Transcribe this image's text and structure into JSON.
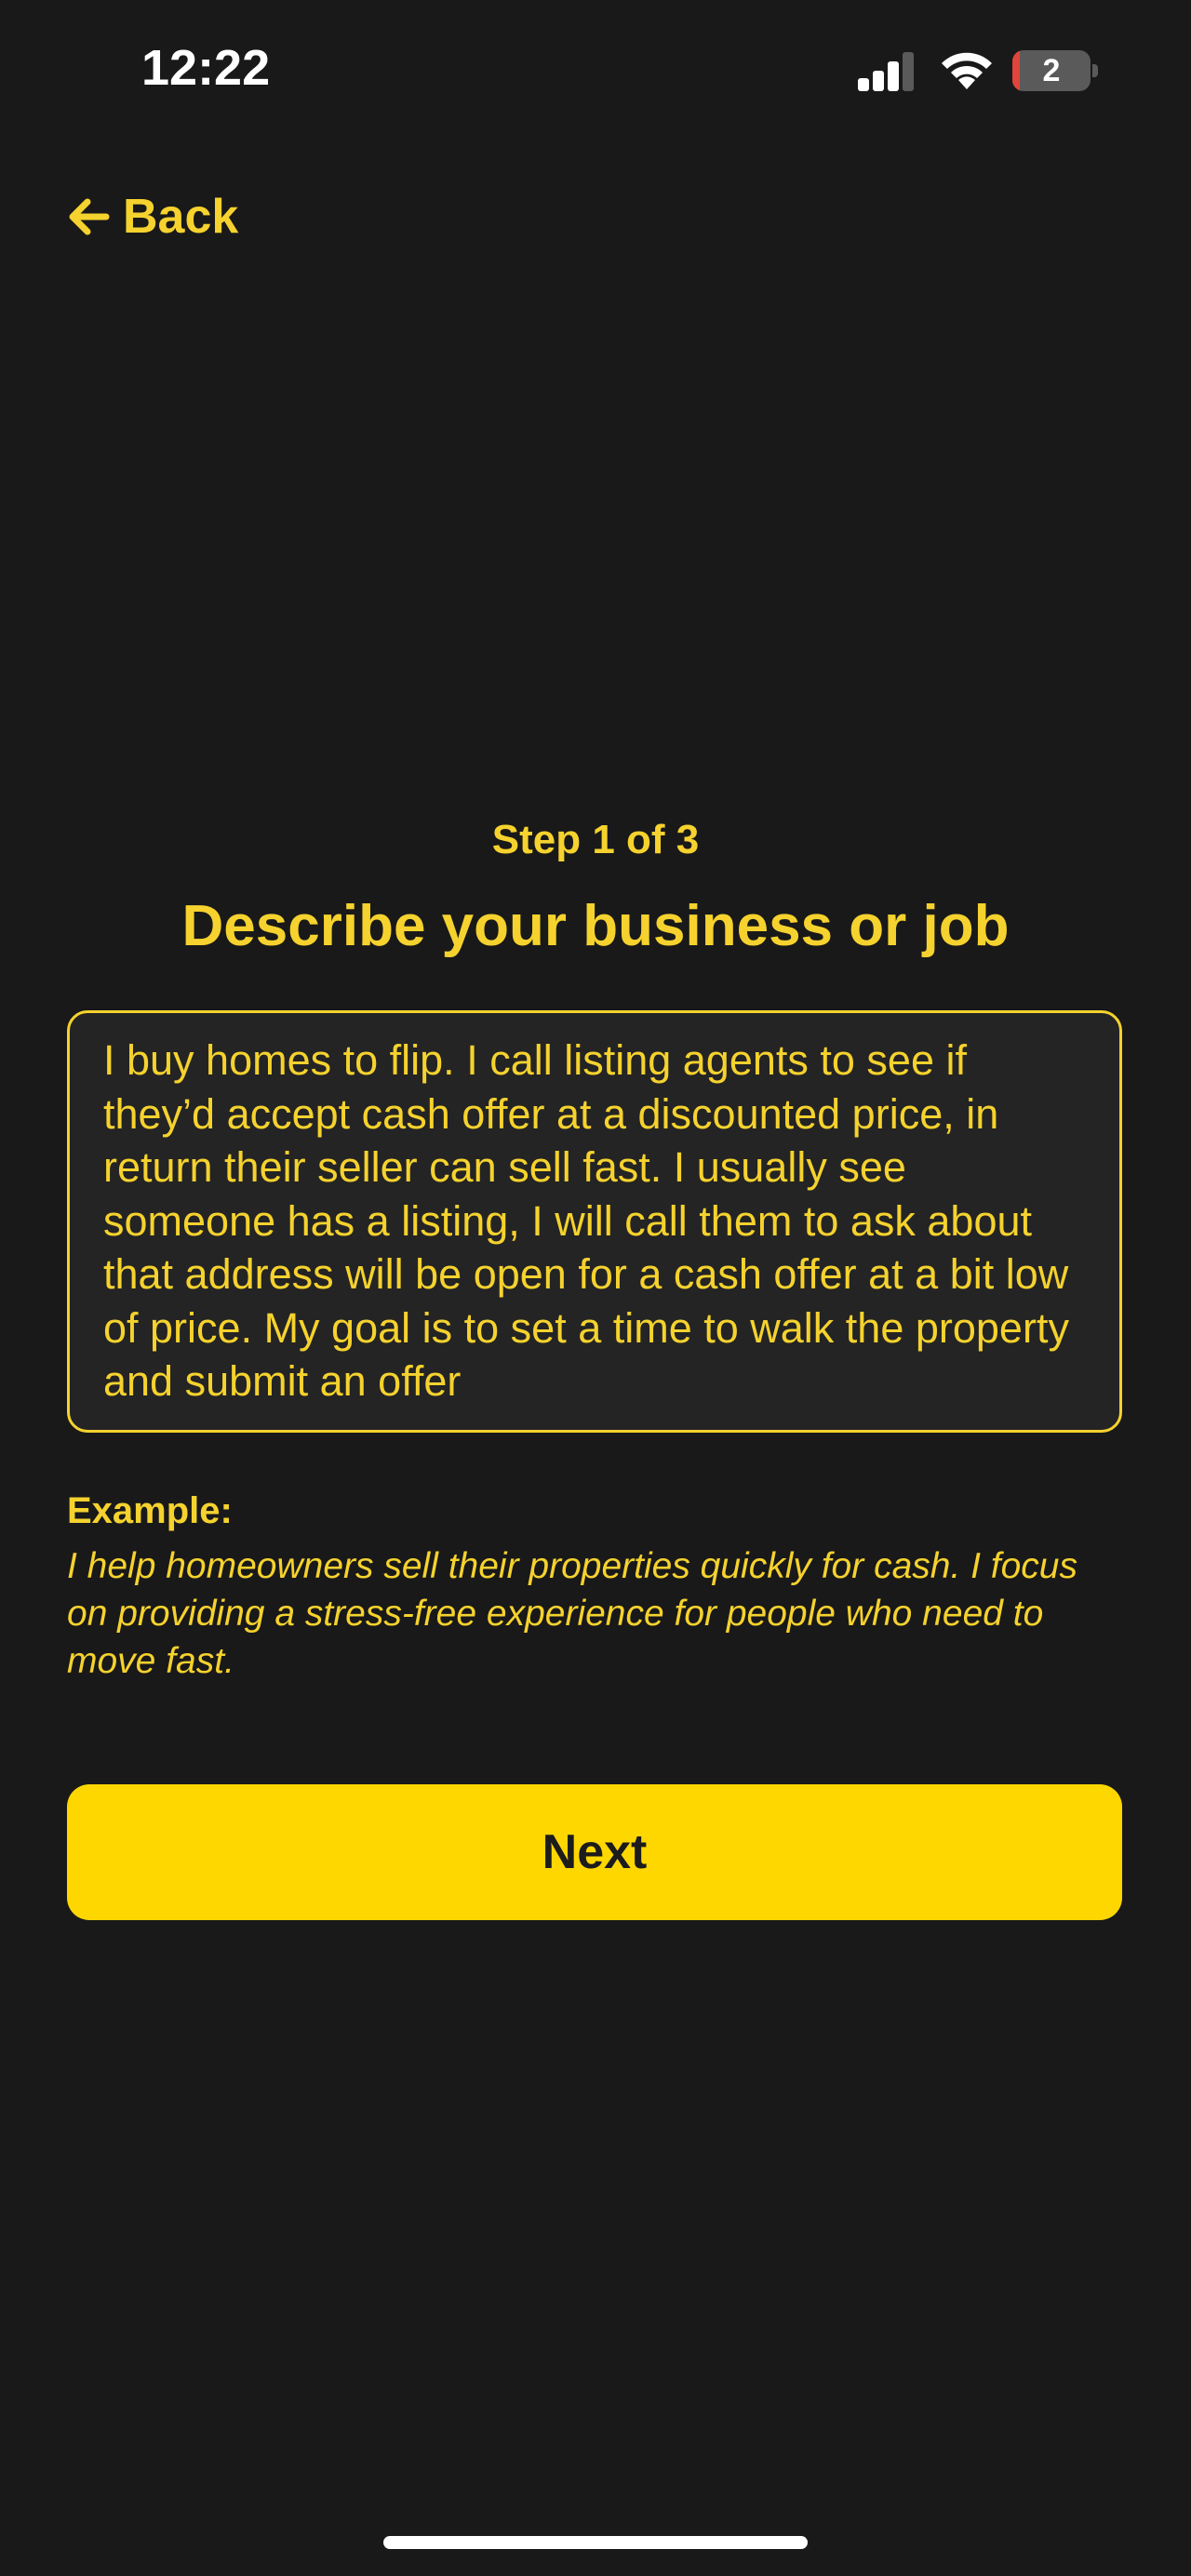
{
  "status_bar": {
    "time": "12:22",
    "battery_level": "2",
    "icons": [
      "signal-icon",
      "wifi-icon",
      "battery-icon"
    ]
  },
  "nav": {
    "back_label": "Back",
    "back_icon": "arrow-left-icon"
  },
  "form": {
    "step_label": "Step 1 of 3",
    "title": "Describe your business or job",
    "description_value": "I buy homes to flip. I call listing agents to see if they’d accept cash offer at a discounted price, in return their seller can sell fast. I usually see someone has a listing, I will call them to ask about that address will be open for a cash offer at a bit low of price. My goal is to set a time to walk the property and submit an offer",
    "example_label": "Example:",
    "example_text": "I help homeowners sell their properties quickly for cash. I focus on providing a stress-free experience for people who need to move fast.",
    "next_label": "Next"
  },
  "colors": {
    "background": "#191919",
    "accent": "#F5D22E",
    "button": "#FFD700",
    "field_background": "#242424"
  }
}
